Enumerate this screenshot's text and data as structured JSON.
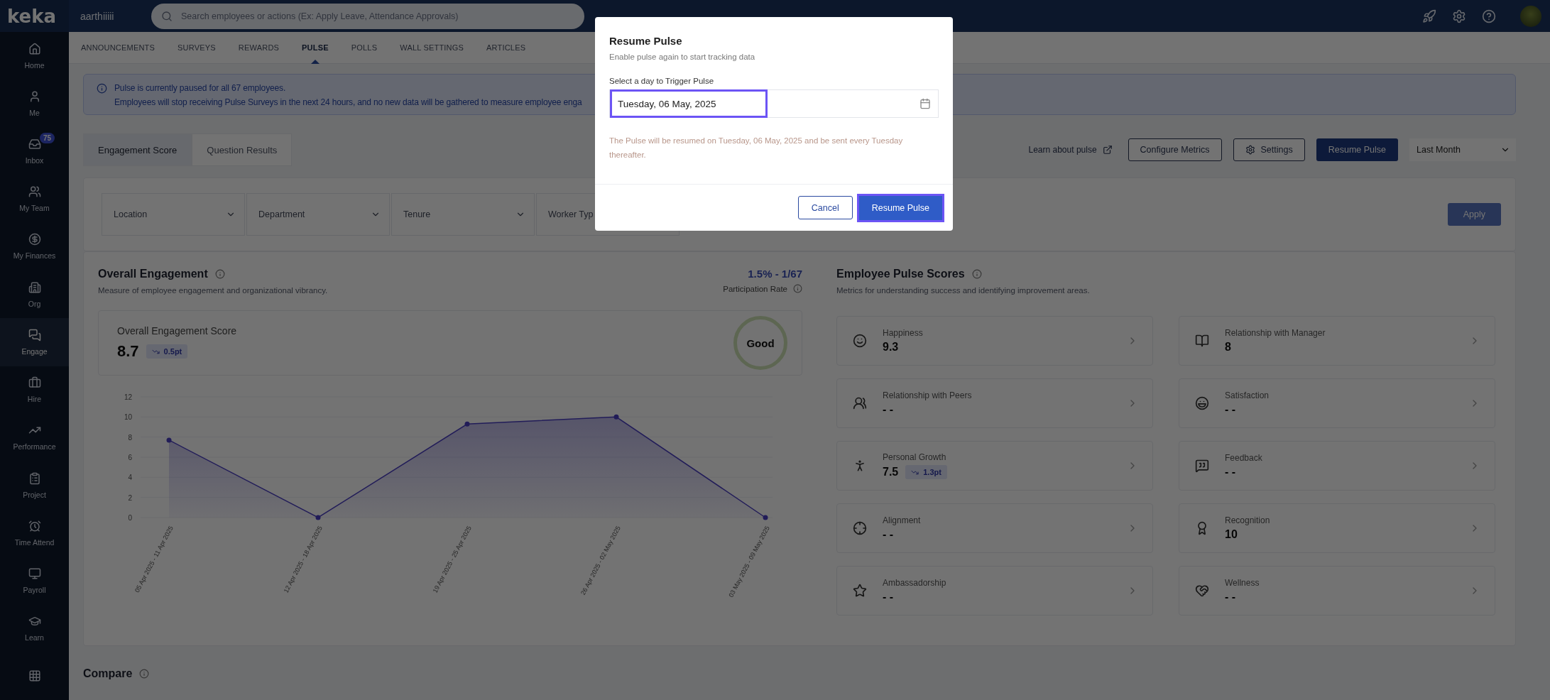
{
  "topbar": {
    "logo": "keka",
    "org": "aarthiiiii",
    "search_placeholder": "Search employees or actions (Ex: Apply Leave, Attendance Approvals)"
  },
  "sidebar": {
    "items": [
      {
        "label": "Home",
        "selected": false
      },
      {
        "label": "Me",
        "selected": false
      },
      {
        "label": "Inbox",
        "selected": false,
        "badge": "75"
      },
      {
        "label": "My Team",
        "selected": false
      },
      {
        "label": "My Finances",
        "selected": false
      },
      {
        "label": "Org",
        "selected": false
      },
      {
        "label": "Engage",
        "selected": true
      },
      {
        "label": "Hire",
        "selected": false
      },
      {
        "label": "Performance",
        "selected": false
      },
      {
        "label": "Project",
        "selected": false
      },
      {
        "label": "Time Attend",
        "selected": false
      },
      {
        "label": "Payroll",
        "selected": false
      },
      {
        "label": "Learn",
        "selected": false
      }
    ]
  },
  "subnav": [
    {
      "label": "ANNOUNCEMENTS",
      "selected": false
    },
    {
      "label": "SURVEYS",
      "selected": false
    },
    {
      "label": "REWARDS",
      "selected": false
    },
    {
      "label": "PULSE",
      "selected": true
    },
    {
      "label": "POLLS",
      "selected": false
    },
    {
      "label": "WALL SETTINGS",
      "selected": false
    },
    {
      "label": "ARTICLES",
      "selected": false
    }
  ],
  "banner": {
    "title": "Pulse is currently paused for all 67 employees.",
    "text": "Employees will stop receiving Pulse Surveys in the next 24 hours, and no new data will be gathered to measure employee enga"
  },
  "view_tabs": [
    {
      "label": "Engagement Score",
      "selected": true
    },
    {
      "label": "Question Results",
      "selected": false
    }
  ],
  "actions": {
    "learn_link": "Learn about pulse",
    "configure": "Configure Metrics",
    "settings": "Settings",
    "resume": "Resume Pulse",
    "period": "Last Month"
  },
  "filters": [
    {
      "label": "Location"
    },
    {
      "label": "Department"
    },
    {
      "label": "Tenure"
    },
    {
      "label": "Worker Typ"
    }
  ],
  "apply": "Apply",
  "overall": {
    "title": "Overall Engagement",
    "subtitle": "Measure of employee engagement and organizational vibrancy.",
    "participation": "1.5% - 1/67",
    "participation_label": "Participation Rate",
    "score_label": "Overall Engagement Score",
    "score": "8.7",
    "change": "0.5pt",
    "rating": "Good",
    "chart_data": {
      "type": "area",
      "categories": [
        "05 Apr 2025 - 11 Apr 2025",
        "12 Apr 2025 - 18 Apr 2025",
        "19 Apr 2025 - 25 Apr 2025",
        "26 Apr 2025 - 02 May 2025",
        "03 May 2025 - 09 May 2025"
      ],
      "series": [
        {
          "color": "#4b3fc4",
          "values": [
            7.7,
            0,
            9.3,
            10,
            0
          ]
        }
      ],
      "ylim": [
        0,
        12
      ],
      "grid": true,
      "yticks": [
        0,
        2,
        4,
        6,
        8,
        10,
        12
      ]
    }
  },
  "pulse_scores": {
    "title": "Employee Pulse Scores",
    "subtitle": "Metrics for understanding success and identifying improvement areas.",
    "metrics": [
      {
        "name": "Happiness",
        "value": "9.3"
      },
      {
        "name": "Relationship with Manager",
        "value": "8"
      },
      {
        "name": "Relationship with Peers",
        "value": "- -"
      },
      {
        "name": "Satisfaction",
        "value": "- -"
      },
      {
        "name": "Personal Growth",
        "value": "7.5",
        "change": "1.3pt"
      },
      {
        "name": "Feedback",
        "value": "- -"
      },
      {
        "name": "Alignment",
        "value": "- -"
      },
      {
        "name": "Recognition",
        "value": "10"
      },
      {
        "name": "Ambassadorship",
        "value": "- -"
      },
      {
        "name": "Wellness",
        "value": "- -"
      }
    ]
  },
  "compare": {
    "title": "Compare"
  },
  "modal": {
    "title": "Resume Pulse",
    "subtitle": "Enable pulse again to start tracking data",
    "field_label": "Select a day to Trigger Pulse",
    "date": "Tuesday, 06 May, 2025",
    "note": "The Pulse will be resumed on Tuesday, 06 May, 2025 and be sent every Tuesday thereafter.",
    "cancel": "Cancel",
    "confirm": "Resume Pulse"
  }
}
